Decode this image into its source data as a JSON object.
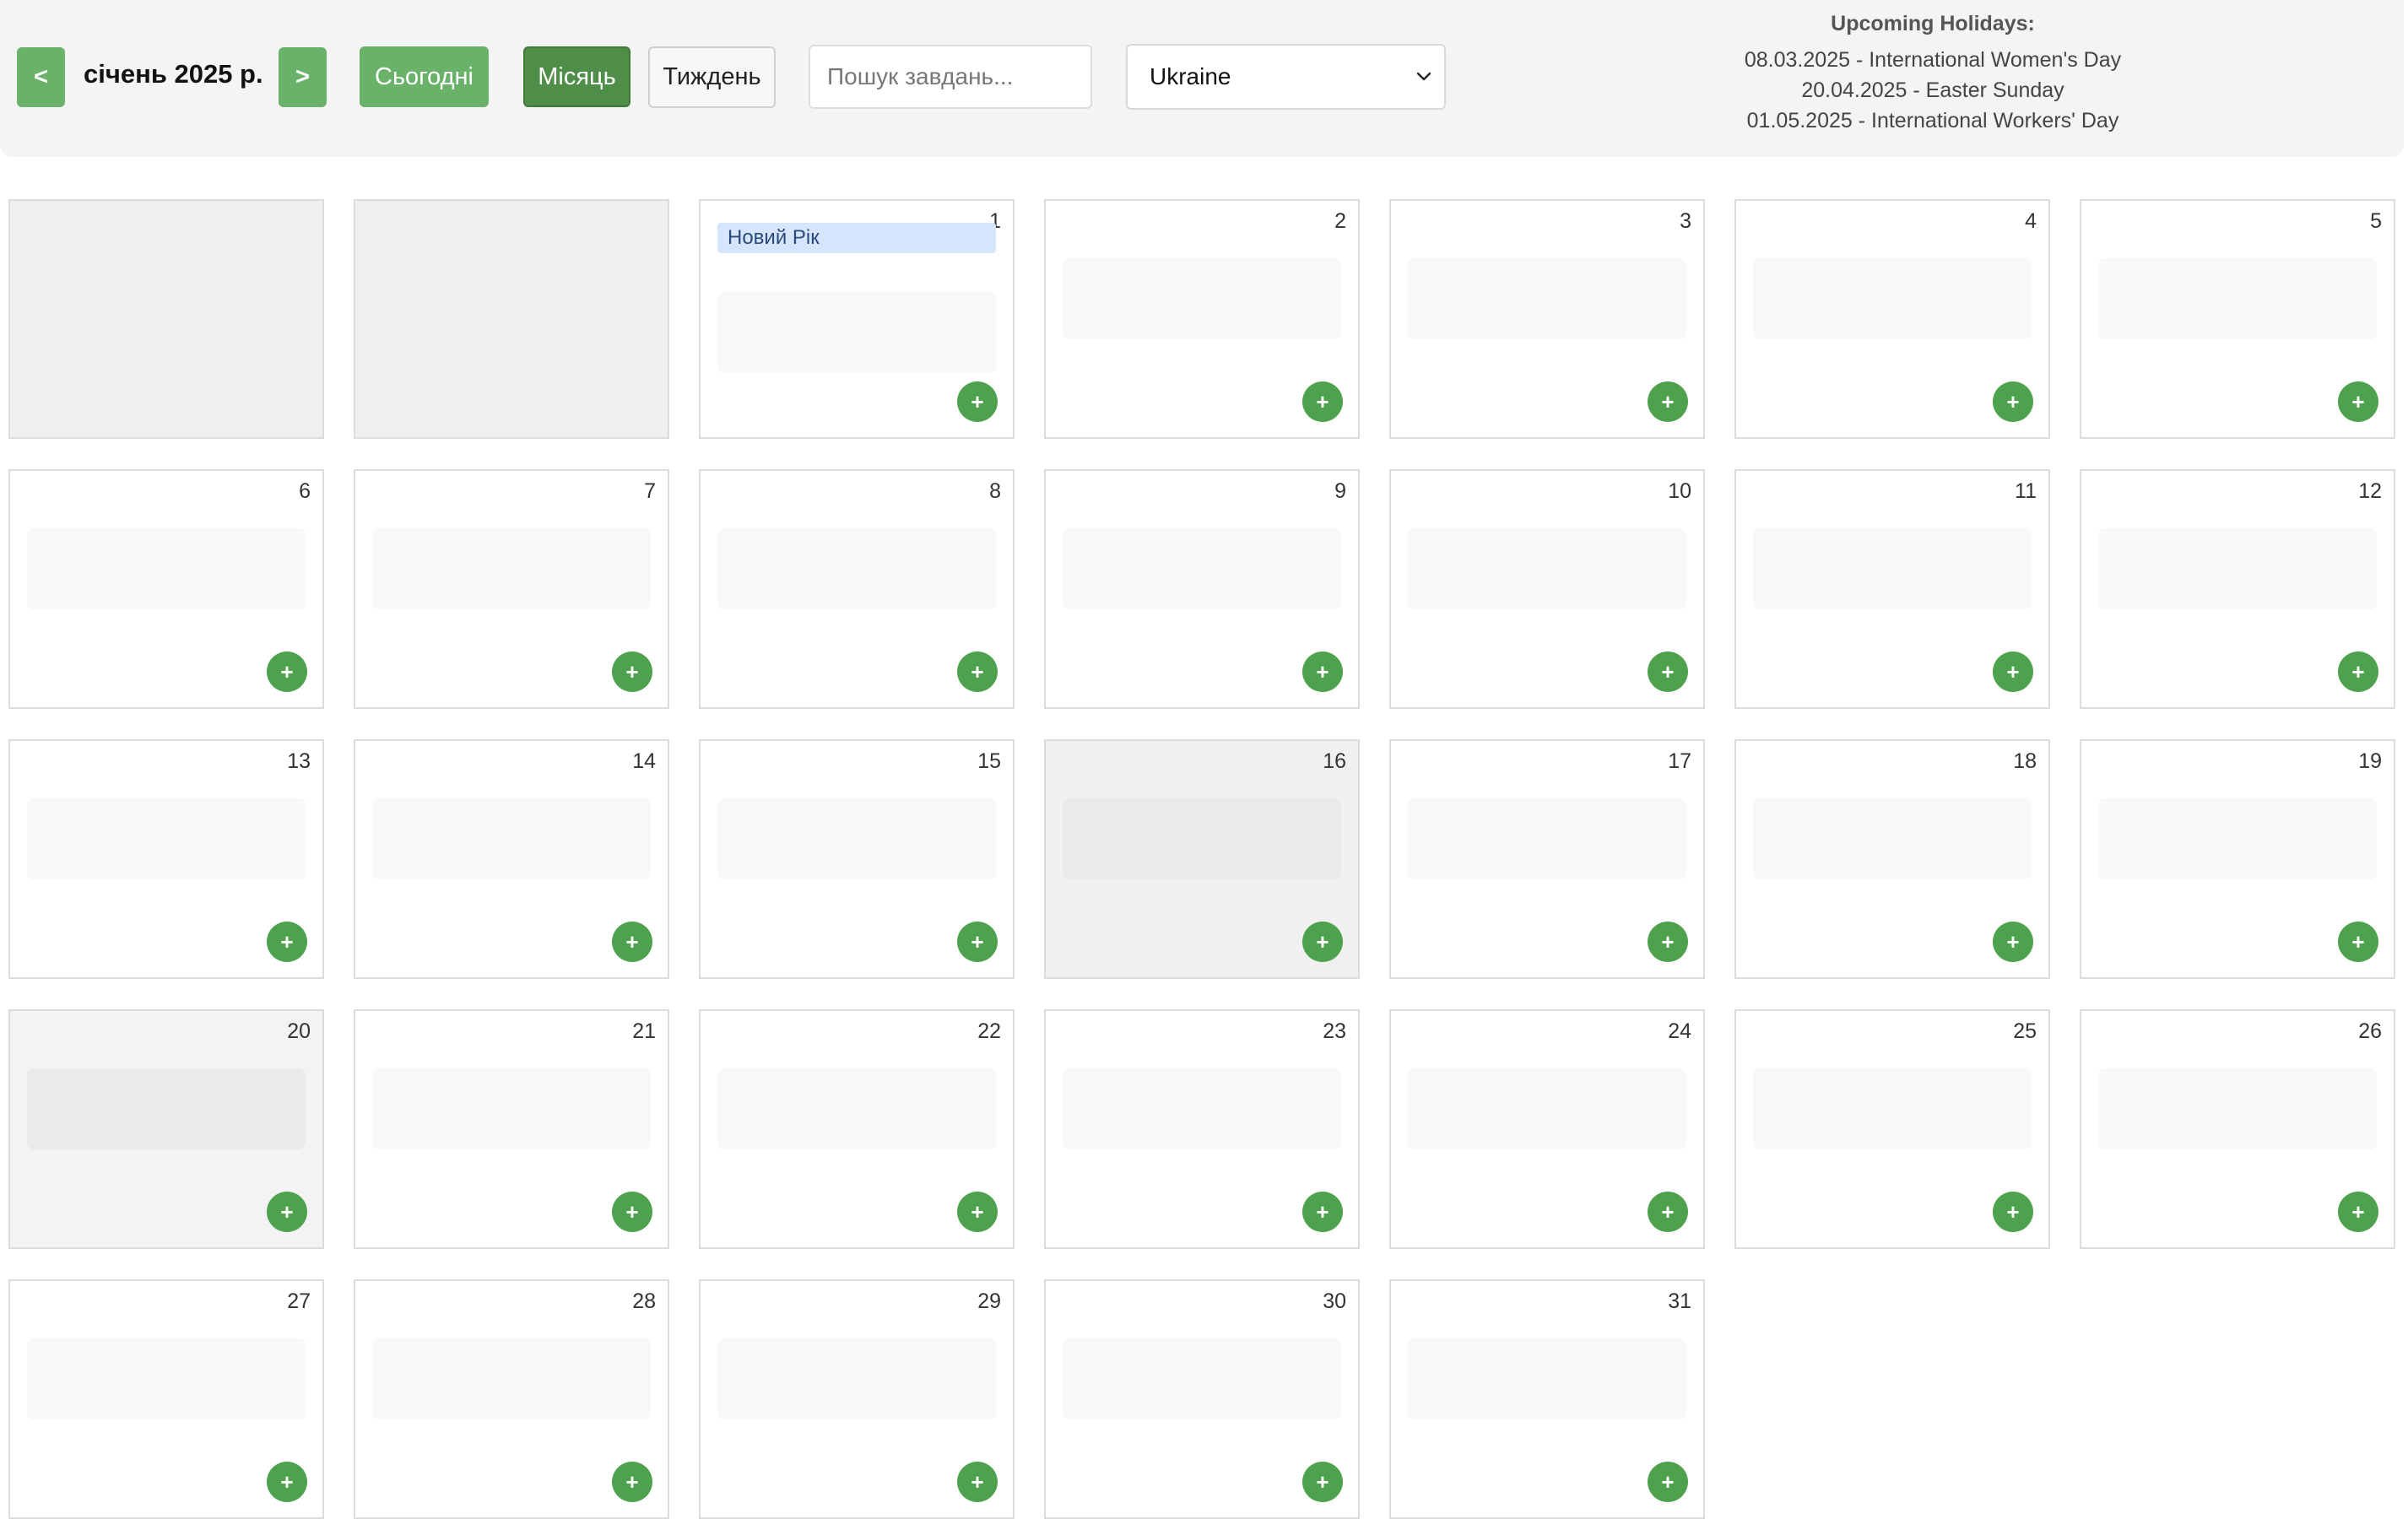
{
  "toolbar": {
    "prev_label": "<",
    "next_label": ">",
    "month_label": "січень 2025 р.",
    "today_label": "Сьогодні",
    "month_view_label": "Місяць",
    "week_view_label": "Тиждень",
    "search_placeholder": "Пошук завдань...",
    "country_selected": "Ukraine"
  },
  "holidays": {
    "title": "Upcoming Holidays:",
    "items": [
      "08.03.2025 - International Women's Day",
      "20.04.2025 - Easter Sunday",
      "01.05.2025 - International Workers' Day"
    ]
  },
  "calendar": {
    "leading_blank_days": 2,
    "days_in_month": 31,
    "highlighted_days": [
      16,
      20
    ],
    "events": [
      {
        "day": 1,
        "label": "Новий Рік"
      }
    ],
    "add_label": "+"
  },
  "colors": {
    "accent": "#6ab26a",
    "accent_active": "#4f8e48",
    "add_button": "#4ea24e",
    "event_bg": "#d6e5fb"
  }
}
